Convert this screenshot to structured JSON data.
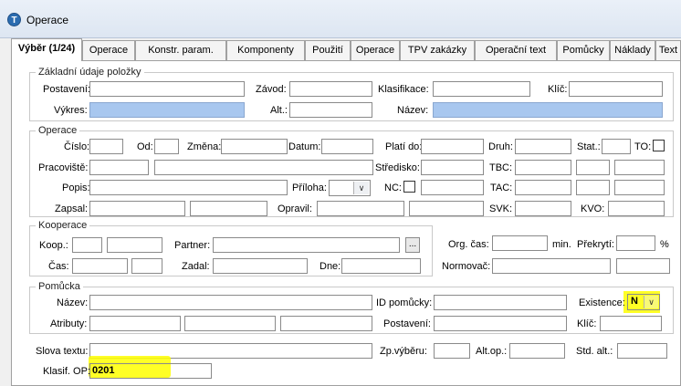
{
  "window": {
    "title": "Operace",
    "icon": "app-logo-icon",
    "icon_glyph": "T"
  },
  "tabs": [
    "Výběr (1/24)",
    "Operace",
    "Konstr. param.",
    "Komponenty",
    "Použití",
    "Operace",
    "TPV zakázky",
    "Operační text",
    "Pomůcky",
    "Náklady",
    "Text"
  ],
  "active_tab": "Výběr (1/24)",
  "basic": {
    "title": "Základní údaje položky",
    "postaveni": "Postavení:",
    "zavod": "Závod:",
    "klasifikace": "Klasifikace:",
    "klic": "Klíč:",
    "vykres": "Výkres:",
    "alt": "Alt.:",
    "nazev": "Název:"
  },
  "operace": {
    "title": "Operace",
    "cislo": "Číslo:",
    "od": "Od:",
    "zmena": "Změna:",
    "datum": "Datum:",
    "plati_do": "Platí do:",
    "druh": "Druh:",
    "stat": "Stat.:",
    "to": "TO:",
    "pracoviste": "Pracoviště:",
    "stredisko": "Středisko:",
    "tbc": "TBC:",
    "popis": "Popis:",
    "priloha": "Příloha:",
    "nc": "NC:",
    "tac": "TAC:",
    "zapsal": "Zapsal:",
    "opravil": "Opravil:",
    "svk": "SVK:",
    "kvo": "KVO:"
  },
  "kooperace": {
    "title": "Kooperace",
    "koop": "Koop.:",
    "partner": "Partner:",
    "cas": "Čas:",
    "zadal": "Zadal:",
    "dne": "Dne:",
    "browse": "..."
  },
  "side": {
    "org_cas": "Org. čas:",
    "min": "min.",
    "prekryti": "Překrytí:",
    "percent": "%",
    "normovac": "Normovač:"
  },
  "pomucka": {
    "title": "Pomůcka",
    "nazev": "Název:",
    "id_pomucky": "ID pomůcky:",
    "existence": "Existence:",
    "existence_value": "N",
    "atributy": "Atributy:",
    "postaveni": "Postavení:",
    "klic": "Klíč:"
  },
  "bottom": {
    "slova_textu": "Slova textu:",
    "zp_vyberu": "Zp.výběru:",
    "alt_op": "Alt.op.:",
    "std_alt": "Std. alt.:",
    "klasif_op": "Klasif. OP:",
    "klasif_op_value": "0201"
  },
  "colors": {
    "highlight": "#ffff00",
    "blue_field": "#a8c7ef"
  }
}
